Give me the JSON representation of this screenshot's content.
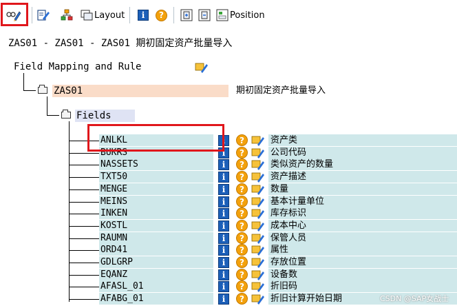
{
  "toolbar": {
    "layout_label": "Layout",
    "position_label": "Position",
    "icons": [
      "display-change-icon",
      "edit-icon",
      "hierarchy-icon",
      "layout-icon",
      "info-icon",
      "help-icon",
      "expand-icon",
      "collapse-icon",
      "position-icon"
    ]
  },
  "page_title": "ZAS01 - ZAS01 - ZAS01 期初固定资产批量导入",
  "tree": {
    "root_label": "Field Mapping and Rule",
    "node": {
      "name": "ZAS01",
      "description": "期初固定资产批量导入",
      "fields_label": "Fields"
    },
    "fields": [
      {
        "name": "ANLKL",
        "description": "资产类"
      },
      {
        "name": "BUKRS",
        "description": "公司代码"
      },
      {
        "name": "NASSETS",
        "description": "类似资产的数量"
      },
      {
        "name": "TXT50",
        "description": "资产描述"
      },
      {
        "name": "MENGE",
        "description": "数量"
      },
      {
        "name": "MEINS",
        "description": "基本计量单位"
      },
      {
        "name": "INKEN",
        "description": "库存标识"
      },
      {
        "name": "KOSTL",
        "description": "成本中心"
      },
      {
        "name": "RAUMN",
        "description": "保管人员"
      },
      {
        "name": "ORD41",
        "description": "属性"
      },
      {
        "name": "GDLGRP",
        "description": "存放位置"
      },
      {
        "name": "EQANZ",
        "description": "设备数"
      },
      {
        "name": "AFASL_01",
        "description": "折旧码"
      },
      {
        "name": "AFABG_01",
        "description": "折旧计算开始日期"
      }
    ]
  },
  "watermark": "CSDN @SAP女战士",
  "colors": {
    "highlight": "#e0161b",
    "field_bg": "#cfe8ea",
    "node_bg": "#fadcc8",
    "fields_bg": "#dfe3f4"
  }
}
